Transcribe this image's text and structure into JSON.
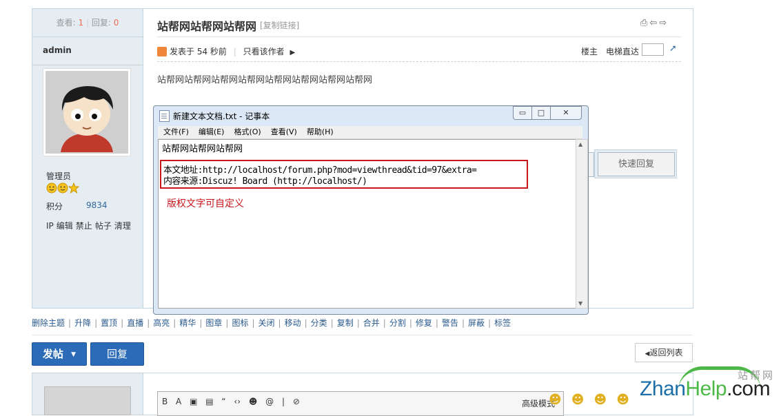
{
  "post": {
    "stats": {
      "views_label": "查看:",
      "views": "1",
      "replies_label": "回复:",
      "replies": "0"
    },
    "author": "admin",
    "title": "站帮网站帮网站帮网",
    "copy_link": "[复制链接]",
    "top_icons": [
      "printer-icon",
      "prev-thread-icon",
      "next-thread-icon"
    ],
    "meta": {
      "posted": "发表于 54 秒前",
      "only_author": "只看该作者"
    },
    "floor_label": "楼主",
    "jump_label": "电梯直达",
    "content": "站帮网站帮网站帮网站帮网站帮网站帮网站帮网站帮网",
    "quick_reply": "快速回复",
    "user": {
      "group": "管理员",
      "points_label": "积分",
      "points": "9834",
      "admin_links": [
        "IP",
        "编辑",
        "禁止",
        "帖子",
        "清理"
      ]
    }
  },
  "mod_actions": [
    "删除主题",
    "升降",
    "置顶",
    "直播",
    "高亮",
    "精华",
    "图章",
    "图标",
    "关闭",
    "移动",
    "分类",
    "复制",
    "合并",
    "分割",
    "修复",
    "警告",
    "屏蔽",
    "标签"
  ],
  "buttons": {
    "new_post": "发帖",
    "reply": "回复",
    "back": "返回列表"
  },
  "editor": {
    "tools": "B A ▣ ▤ “ ‹› ☻ @ | ⊘",
    "advanced": "高级模式"
  },
  "notepad": {
    "title": "新建文本文档.txt - 记事本",
    "menu": [
      "文件(F)",
      "编辑(E)",
      "格式(O)",
      "查看(V)",
      "帮助(H)"
    ],
    "line1": "站帮网站帮网站帮网",
    "line2": "本文地址:http://localhost/forum.php?mod=viewthread&tid=97&extra=",
    "line3": "内容来源:Discuz! Board (http://localhost/)",
    "note": "版权文字可自定义",
    "controls": {
      "minimize": "▭",
      "maximize": "□",
      "close": "✕"
    }
  },
  "watermark": {
    "cn": "站帮网",
    "en_a": "Zhan",
    "en_b": "Help",
    "en_c": ".com"
  },
  "colors": {
    "accent": "#2b6bb8",
    "border": "#c2d5e3",
    "side_bg": "#e5edf2",
    "highlight_red": "#c8161d",
    "count_red": "#f26c4f"
  }
}
